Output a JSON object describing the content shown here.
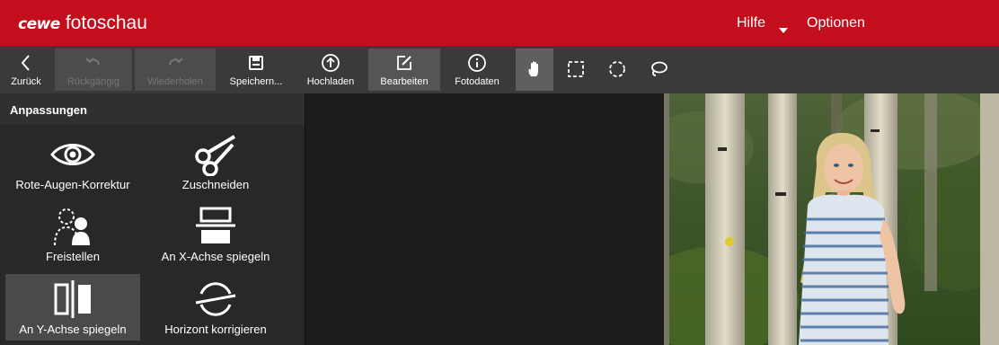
{
  "app": {
    "brand_bold": "cewe",
    "brand_rest": "fotoschau",
    "menu": {
      "help": "Hilfe",
      "options": "Optionen"
    }
  },
  "toolbar": {
    "back": "Zurück",
    "undo": "Rückgängig",
    "redo": "Wiederholen",
    "save": "Speichern...",
    "upload": "Hochladen",
    "edit": "Bearbeiten",
    "photo_data": "Fotodaten"
  },
  "tools": [
    "hand-tool",
    "rectangle-select",
    "ellipse-select",
    "lasso-select"
  ],
  "panel": {
    "title": "Anpassungen",
    "items": [
      {
        "label": "Rote-Augen-Korrektur",
        "icon": "eye-icon"
      },
      {
        "label": "Zuschneiden",
        "icon": "scissors-icon"
      },
      {
        "label": "Freistellen",
        "icon": "cutout-person-icon"
      },
      {
        "label": "An X-Achse spiegeln",
        "icon": "flip-horizontal-axis-icon"
      },
      {
        "label": "An Y-Achse spiegeln",
        "icon": "flip-vertical-axis-icon",
        "selected": true
      },
      {
        "label": "Horizont korrigieren",
        "icon": "horizon-icon"
      }
    ]
  },
  "colors": {
    "titlebar": "#c30e1e",
    "toolbar": "#3a3a3a",
    "panel": "#282828",
    "canvas": "#1d1c1b"
  }
}
